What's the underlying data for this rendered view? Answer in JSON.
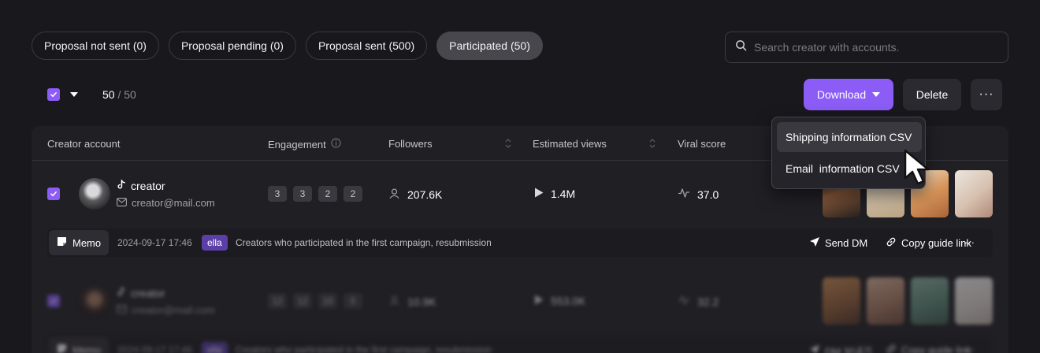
{
  "tabs": [
    {
      "label": "Proposal not sent (0)",
      "active": false
    },
    {
      "label": "Proposal pending (0)",
      "active": false
    },
    {
      "label": "Proposal sent (500)",
      "active": false
    },
    {
      "label": "Participated (50)",
      "active": true
    }
  ],
  "search": {
    "placeholder": "Search creator with accounts."
  },
  "selection": {
    "selected": "50",
    "total": "/ 50"
  },
  "toolbar": {
    "download_label": "Download",
    "delete_label": "Delete",
    "more_label": "···"
  },
  "dropdown": {
    "items": [
      "Shipping information CSV",
      "Email  information CSV"
    ],
    "hovered_index": 0
  },
  "table": {
    "columns": {
      "creator_account": "Creator account",
      "engagement": "Engagement",
      "followers": "Followers",
      "estimated_views": "Estimated views",
      "viral_score": "Viral score"
    },
    "rows": [
      {
        "name": "creator",
        "email": "creator@mail.com",
        "engagement": [
          "3",
          "3",
          "2",
          "2"
        ],
        "followers": "207.6K",
        "views": "1.4M",
        "viral_score": "37.0",
        "memo": {
          "label": "Memo",
          "date": "2024-09-17 17:46",
          "user": "ella",
          "text": "Creators who participated in the first campaign, resubmission",
          "send_dm": "Send DM",
          "copy_link": "Copy guide link",
          "more": "···"
        }
      },
      {
        "name": "creator",
        "email": "creator@mail.com",
        "engagement": [
          "12",
          "12",
          "10",
          "5"
        ],
        "followers": "10.9K",
        "views": "553.0K",
        "viral_score": "32.2",
        "memo": {
          "label": "Memo",
          "date": "2024-09-17 17:46",
          "user": "ella",
          "text": "Creators who participated in the first campaign, resubmission",
          "send_dm": "DM 보내기",
          "copy_link": "Copy guide link",
          "more": "···"
        }
      }
    ]
  },
  "colors": {
    "accent": "#8b5cf6",
    "background": "#19181d",
    "panel": "#201f24"
  }
}
